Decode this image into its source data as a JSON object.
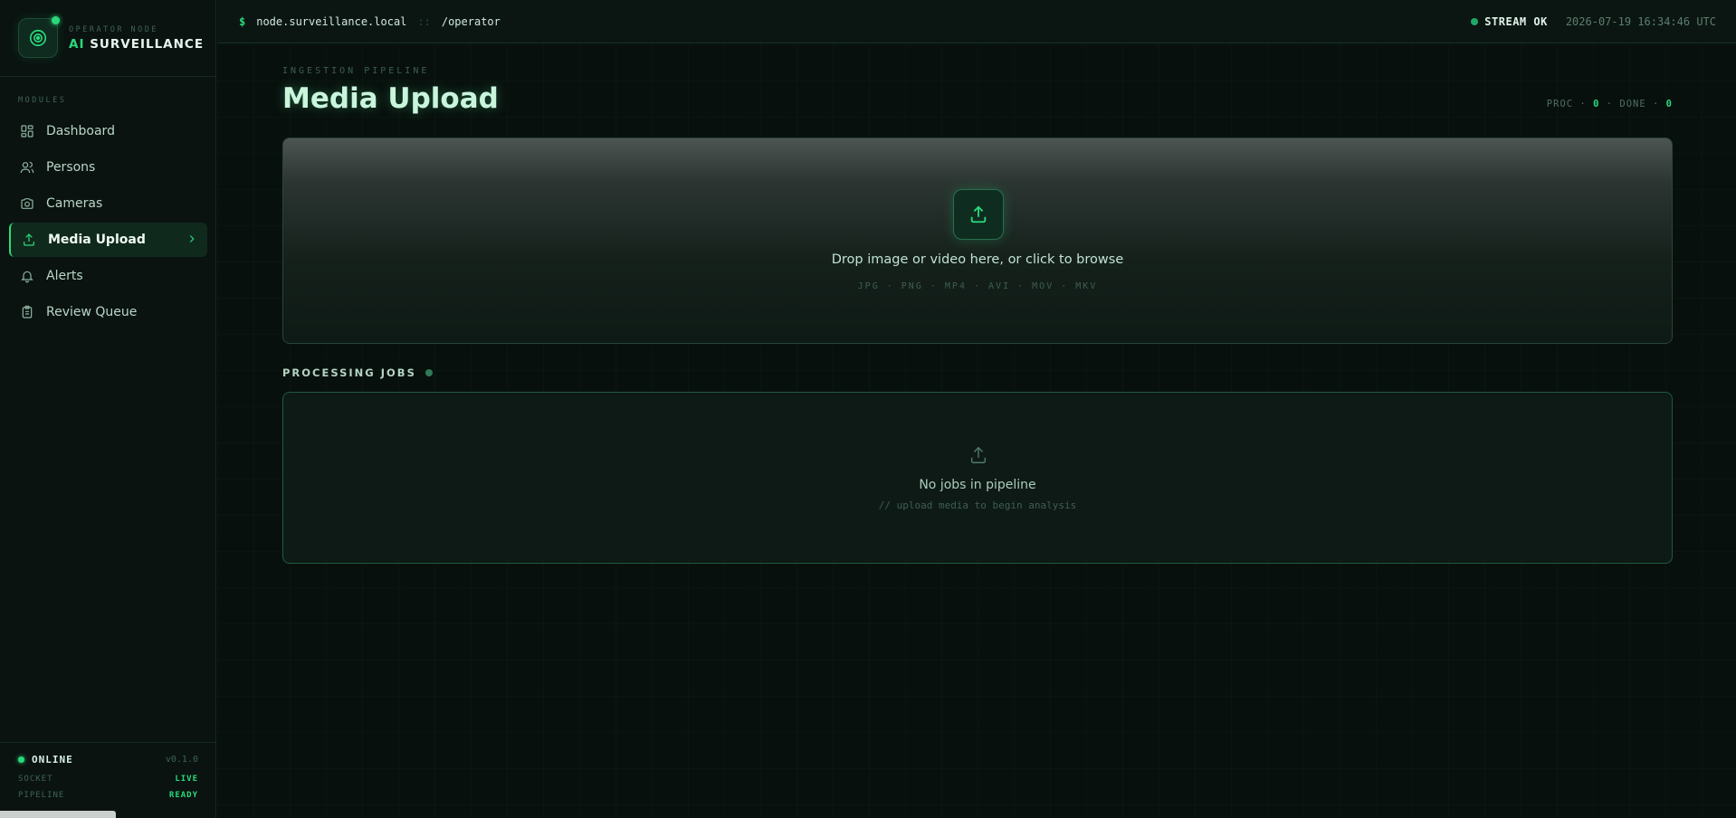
{
  "brand": {
    "subtitle": "OPERATOR NODE",
    "title_accent": "AI",
    "title_rest": "SURVEILLANCE"
  },
  "sidebar": {
    "section_label": "MODULES",
    "items": [
      {
        "label": "Dashboard",
        "icon": "dashboard-icon",
        "active": false
      },
      {
        "label": "Persons",
        "icon": "users-icon",
        "active": false
      },
      {
        "label": "Cameras",
        "icon": "camera-icon",
        "active": false
      },
      {
        "label": "Media Upload",
        "icon": "upload-icon",
        "active": true
      },
      {
        "label": "Alerts",
        "icon": "bell-icon",
        "active": false
      },
      {
        "label": "Review Queue",
        "icon": "clipboard-icon",
        "active": false
      }
    ],
    "footer": {
      "status": "ONLINE",
      "version": "v0.1.0",
      "socket_label": "SOCKET",
      "socket_value": "LIVE",
      "pipeline_label": "PIPELINE",
      "pipeline_value": "READY"
    }
  },
  "topbar": {
    "prompt": "$",
    "host": "node.surveillance.local",
    "separator": "::",
    "path": "/operator",
    "stream_status": "STREAM OK",
    "timestamp": "2026-07-19 16:34:46 UTC"
  },
  "main": {
    "eyebrow": "INGESTION PIPELINE",
    "title": "Media Upload",
    "counters": {
      "proc_label": "PROC",
      "proc_value": "0",
      "done_label": "DONE",
      "done_value": "0",
      "dot": "·"
    },
    "dropzone": {
      "text": "Drop image or video here, or click to browse",
      "formats": "JPG · PNG · MP4 · AVI · MOV · MKV"
    },
    "jobs": {
      "heading": "PROCESSING JOBS",
      "empty_title": "No jobs in pipeline",
      "empty_hint": "// upload media to begin analysis"
    }
  },
  "colors": {
    "accent": "#2bd97c",
    "background": "#070d0b",
    "panel": "#0a1310"
  }
}
